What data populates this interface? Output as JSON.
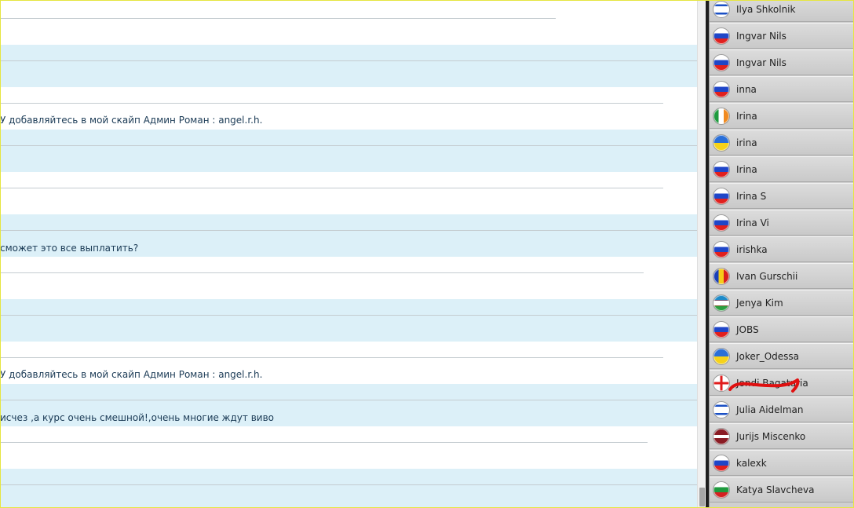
{
  "chat": {
    "messages": [
      "У добавляйтесь в  мой скайп Админ Роман : angel.r.h.",
      "сможет это все выплатить?",
      "У добавляйтесь в  мой скайп Админ Роман : angel.r.h.",
      "исчез ,а курс очень смешной!,очень многие ждут виво"
    ]
  },
  "users": [
    {
      "name": "Ilya Shkolnik",
      "flag": "israel-flag-icon"
    },
    {
      "name": "Ingvar Nils",
      "flag": "russia-flag-icon"
    },
    {
      "name": "Ingvar Nils",
      "flag": "russia-flag-icon"
    },
    {
      "name": "inna",
      "flag": "russia-flag-icon"
    },
    {
      "name": "Irina",
      "flag": "ireland-flag-icon"
    },
    {
      "name": "irina",
      "flag": "ukraine-flag-icon"
    },
    {
      "name": "Irina",
      "flag": "russia-flag-icon"
    },
    {
      "name": "Irina S",
      "flag": "russia-flag-icon"
    },
    {
      "name": "Irina Vi",
      "flag": "russia-flag-icon"
    },
    {
      "name": "irishka",
      "flag": "russia-flag-icon"
    },
    {
      "name": "Ivan Gurschii",
      "flag": "moldova-flag-icon"
    },
    {
      "name": "Jenya Kim",
      "flag": "uzbekistan-flag-icon"
    },
    {
      "name": "JOBS",
      "flag": "russia-flag-icon"
    },
    {
      "name": "Joker_Odessa",
      "flag": "ukraine-flag-icon"
    },
    {
      "name": "Jondi Bagaturia",
      "flag": "georgia-flag-icon"
    },
    {
      "name": "Julia Aidelman",
      "flag": "israel-flag-icon"
    },
    {
      "name": "Jurijs Miscenko",
      "flag": "latvia-flag-icon"
    },
    {
      "name": "kalexk",
      "flag": "russia-flag-icon"
    },
    {
      "name": "Katya Slavcheva",
      "flag": "bulgaria-flag-icon"
    }
  ],
  "colors": {
    "row_blue": "#dcf0f8",
    "highlight_scribble": "#e01010"
  }
}
